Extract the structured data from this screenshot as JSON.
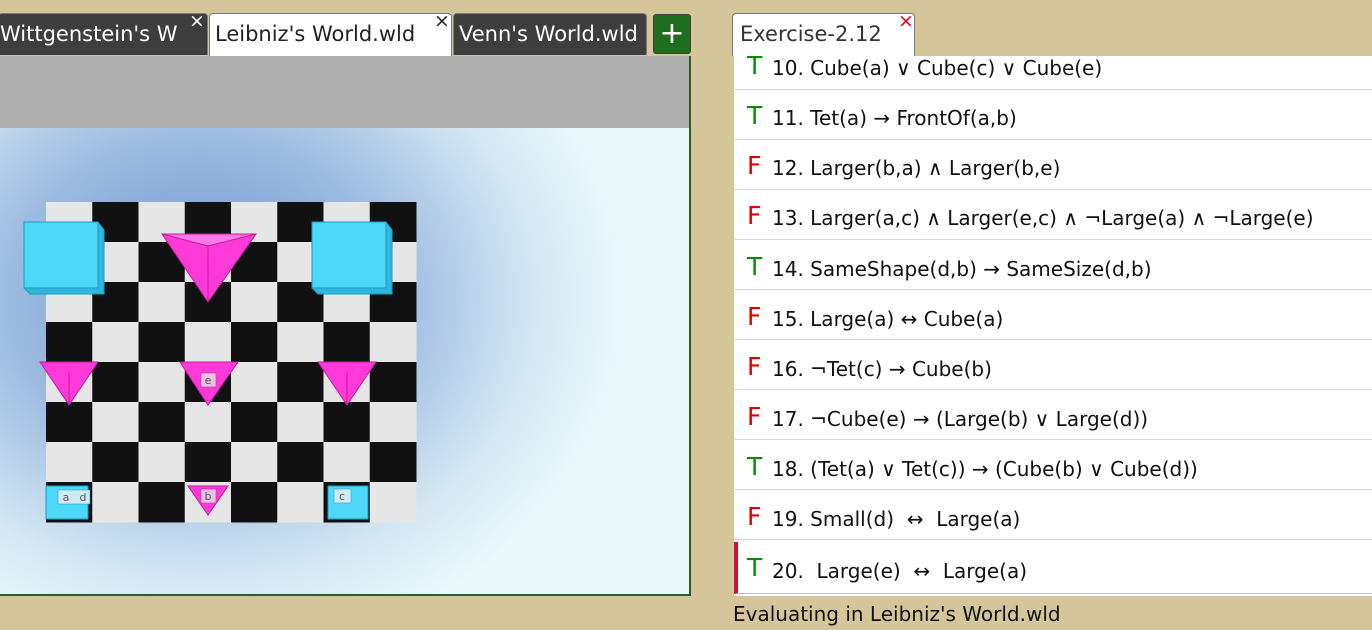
{
  "world_tabs": [
    {
      "label": "Wittgenstein's W",
      "active": false,
      "close": "×"
    },
    {
      "label": "Leibniz's World.wld",
      "active": true,
      "close": "×"
    },
    {
      "label": "Venn's World.wld",
      "active": false
    }
  ],
  "add_tab_label": "+",
  "world": {
    "labels": {
      "e": "e",
      "b": "b",
      "a": "a",
      "d": "d",
      "c": "c"
    }
  },
  "exercise_tab": {
    "label": "Exercise-2.12",
    "close": "×"
  },
  "sentences": [
    {
      "value": "T",
      "text": "10. Cube(a) ∨ Cube(c) ∨ Cube(e)"
    },
    {
      "value": "T",
      "text": "11. Tet(a) → FrontOf(a,b)"
    },
    {
      "value": "F",
      "text": "12. Larger(b,a) ∧ Larger(b,e)"
    },
    {
      "value": "F",
      "text": "13. Larger(a,c) ∧ Larger(e,c) ∧ ¬Large(a) ∧ ¬Large(e)"
    },
    {
      "value": "T",
      "text": "14. SameShape(d,b) → SameSize(d,b)"
    },
    {
      "value": "F",
      "text": "15. Large(a) ↔ Cube(a)"
    },
    {
      "value": "F",
      "text": "16. ¬Tet(c) → Cube(b)"
    },
    {
      "value": "F",
      "text": "17. ¬Cube(e) → (Large(b) ∨ Large(d))"
    },
    {
      "value": "T",
      "text": "18. (Tet(a) ∨ Tet(c)) → (Cube(b) ∨ Cube(d))"
    },
    {
      "value": "F",
      "text": "19. Small(d)  ↔  Large(a)"
    },
    {
      "value": "T",
      "text": "20.  Large(e)  ↔  Large(a)"
    }
  ],
  "status": "Evaluating in Leibniz's World.wld",
  "colors": {
    "true": "#0a8a0a",
    "false": "#e00000",
    "cube": "#4dd8f9",
    "tet": "#ff3ad8",
    "tab_dark": "#3e3e3e",
    "add_button": "#1f6d1f"
  }
}
